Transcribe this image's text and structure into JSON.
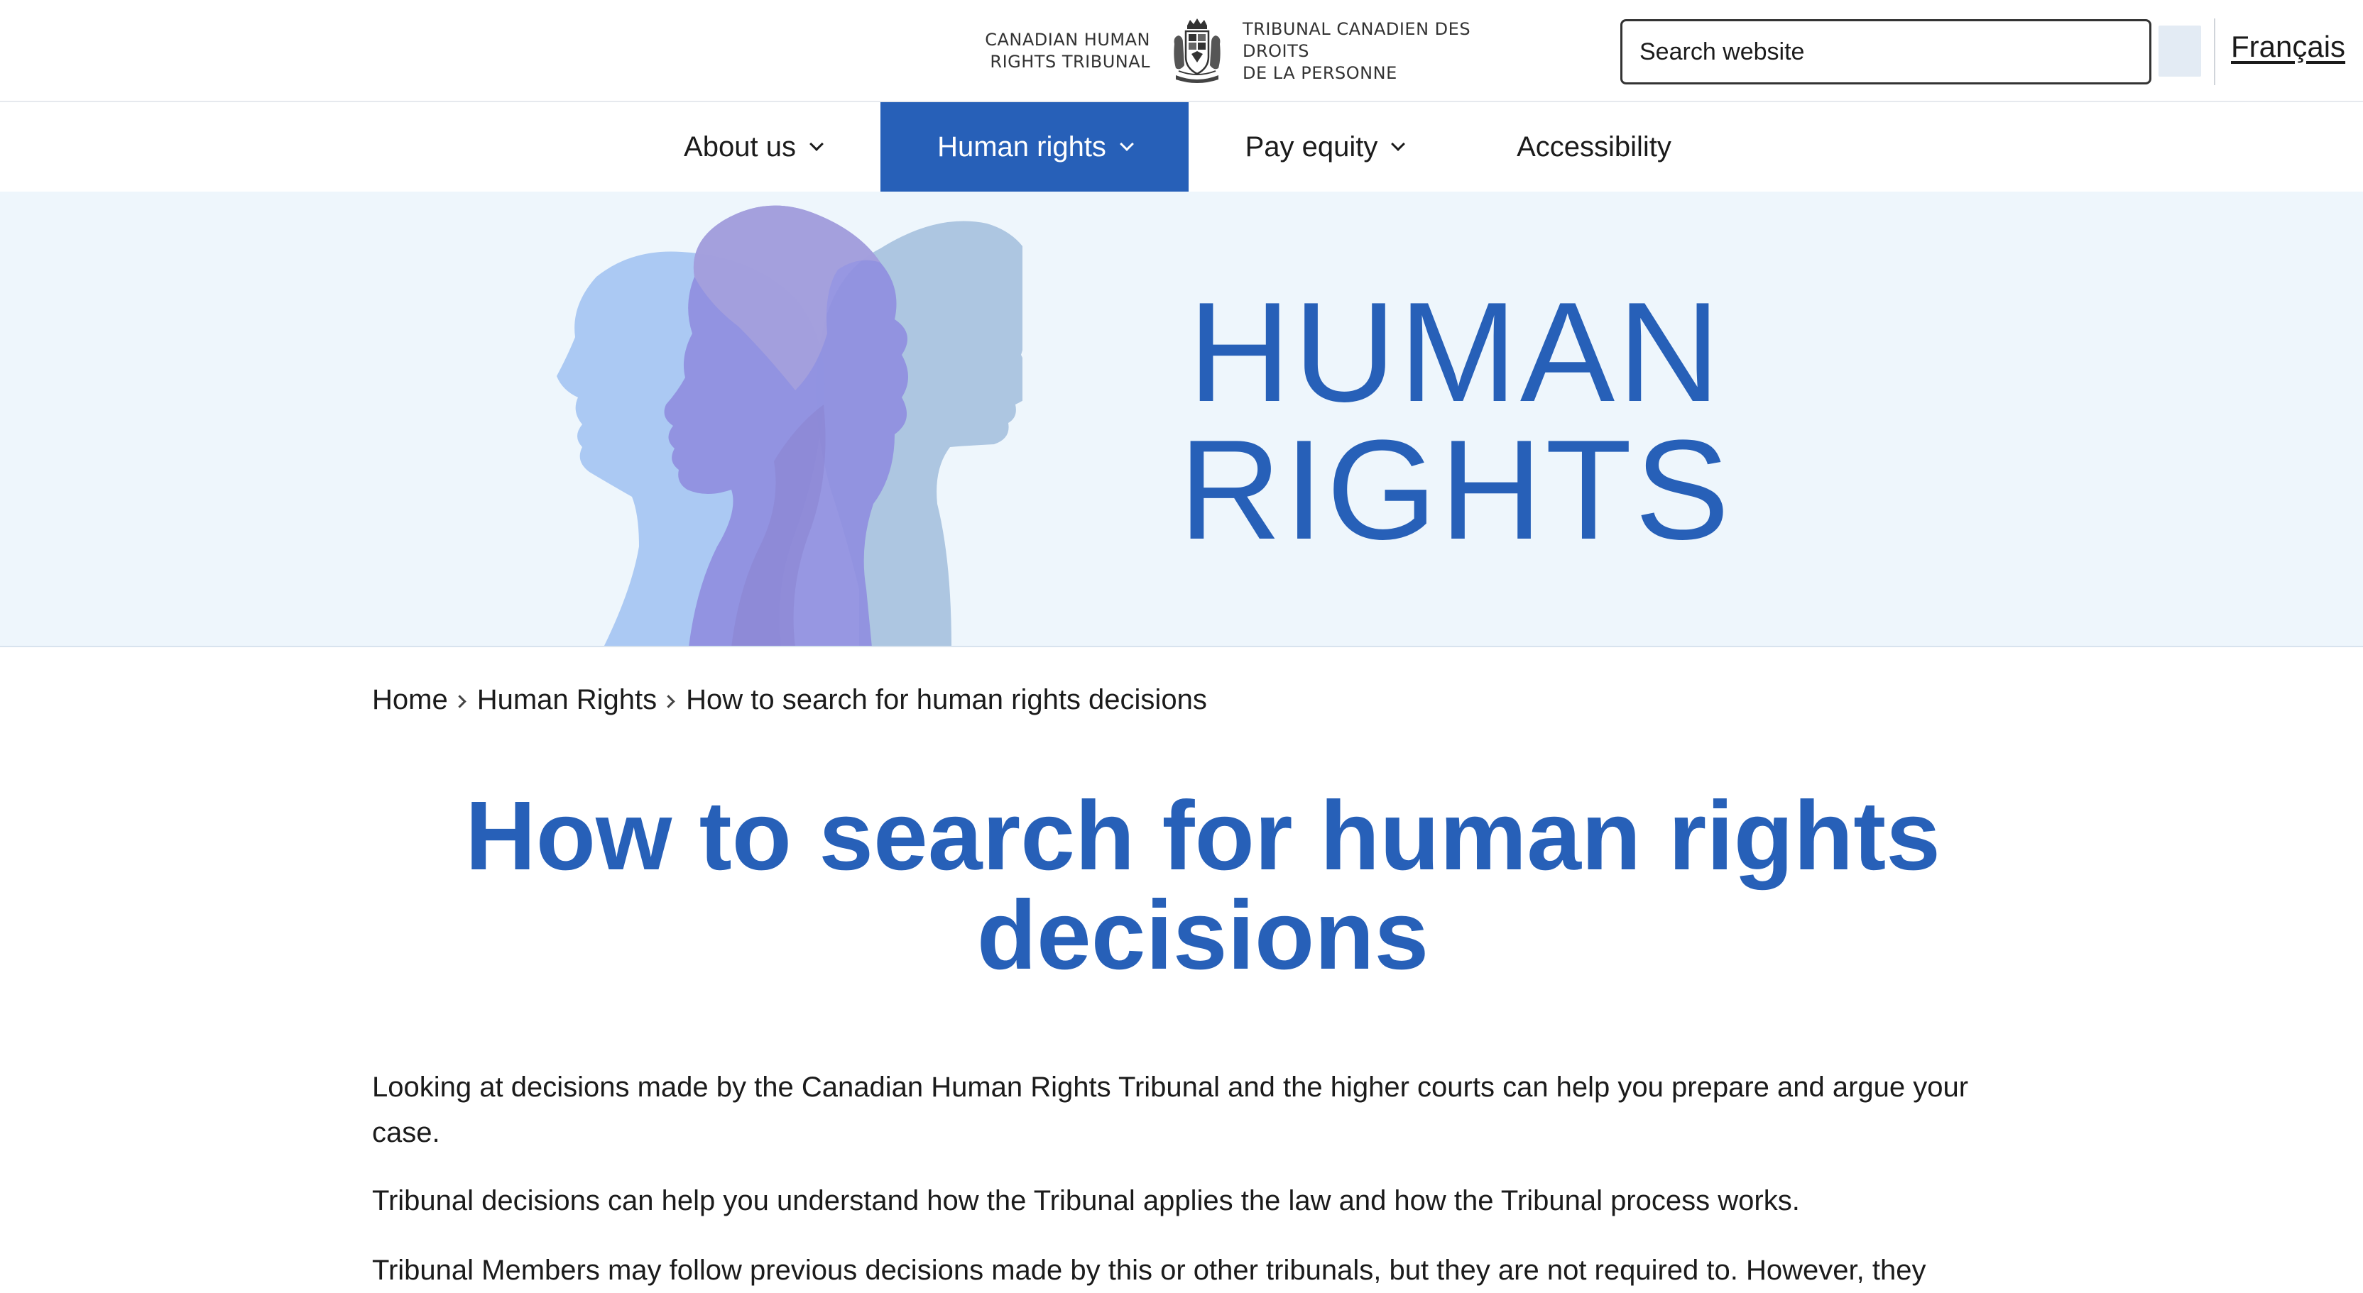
{
  "header": {
    "logo": {
      "english_name": "CANADIAN HUMAN\nRIGHTS TRIBUNAL",
      "french_name": "TRIBUNAL CANADIEN DES DROITS\nDE LA PERSONNE"
    },
    "search": {
      "placeholder": "Search website"
    },
    "language_toggle": "Français"
  },
  "nav": {
    "items": [
      {
        "label": "About us",
        "has_dropdown": true,
        "active": false
      },
      {
        "label": "Human rights",
        "has_dropdown": true,
        "active": true
      },
      {
        "label": "Pay equity",
        "has_dropdown": true,
        "active": false
      },
      {
        "label": "Accessibility",
        "has_dropdown": false,
        "active": false
      }
    ]
  },
  "hero": {
    "title": "HUMAN\nRIGHTS",
    "image": "head-silhouettes"
  },
  "breadcrumb": {
    "items": [
      "Home",
      "Human Rights",
      "How to search for human rights decisions"
    ]
  },
  "main": {
    "title": "How to search for human rights decisions",
    "paragraphs": [
      "Looking at decisions made by the Canadian Human Rights Tribunal and the higher courts can help you prepare and argue your case.",
      "Tribunal decisions can help you understand how the Tribunal applies the law and how the Tribunal process works.",
      "Tribunal Members may follow previous decisions made by this or other tribunals, but they are not required to. However, they"
    ]
  },
  "colors": {
    "brand_blue": "#2760b8",
    "hero_background": "#eef6fc",
    "search_button": "#e3ebf4"
  }
}
